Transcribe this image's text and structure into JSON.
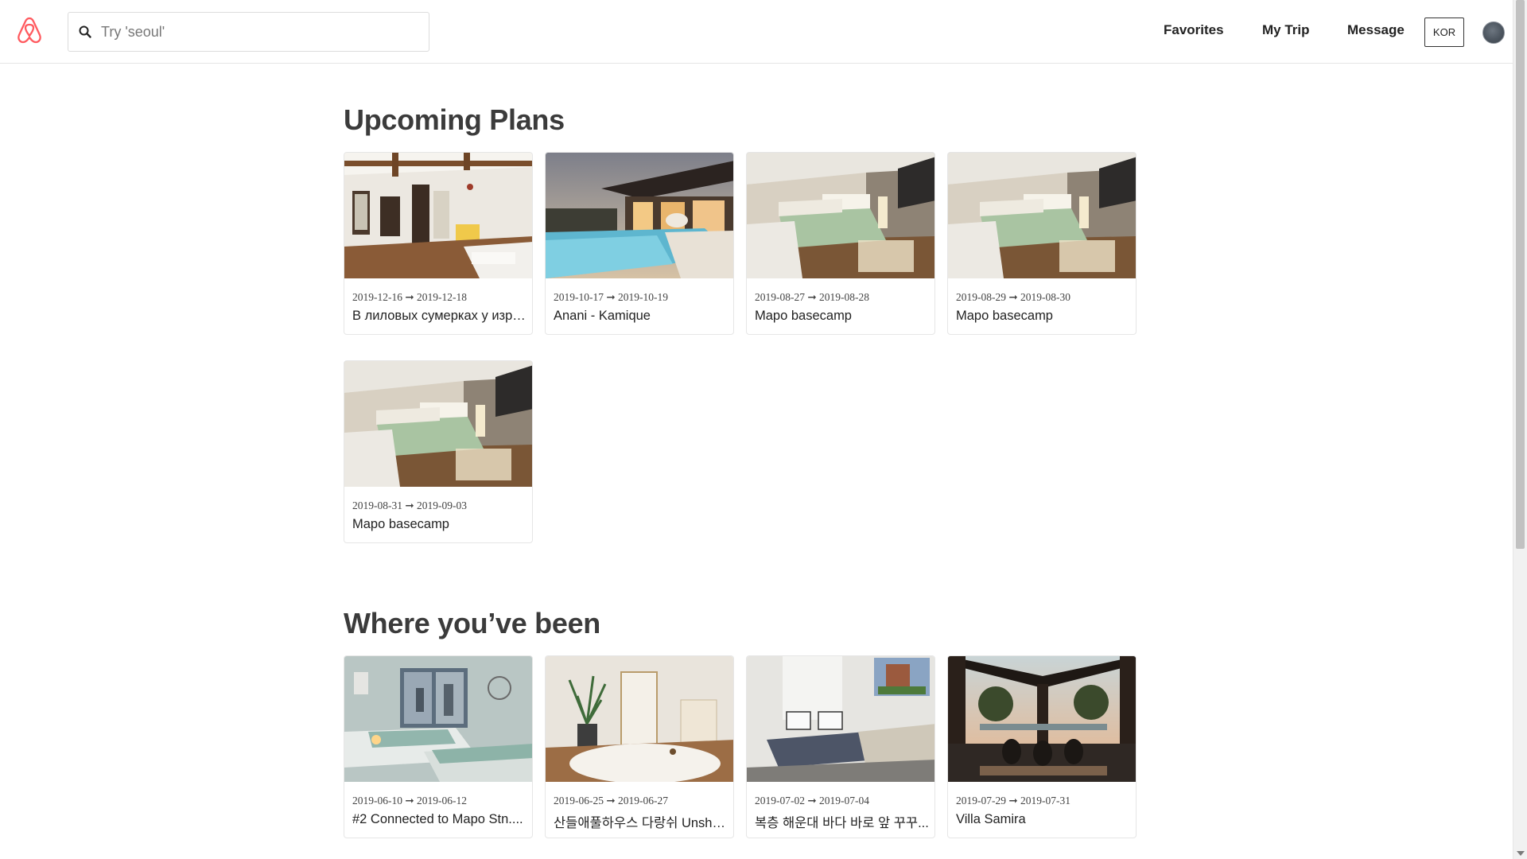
{
  "header": {
    "search_placeholder": "Try 'seoul'",
    "nav": [
      "Favorites",
      "My Trip",
      "Message"
    ],
    "lang": "KOR",
    "brand_color": "#ff5a5f"
  },
  "upcoming": {
    "title": "Upcoming Plans",
    "cards": [
      {
        "dates": "2019-12-16 ➞ 2019-12-18",
        "name": "В лиловых сумерках у изра...",
        "image": "loft-living-room"
      },
      {
        "dates": "2019-10-17 ➞ 2019-10-19",
        "name": "Anani - Kamique",
        "image": "pool-villa-dusk"
      },
      {
        "dates": "2019-08-27 ➞ 2019-08-28",
        "name": "Mapo basecamp",
        "image": "bedroom-green-bed"
      },
      {
        "dates": "2019-08-29 ➞ 2019-08-30",
        "name": "Mapo basecamp",
        "image": "bedroom-green-bed"
      },
      {
        "dates": "2019-08-31 ➞ 2019-09-03",
        "name": "Mapo basecamp",
        "image": "bedroom-green-bed"
      }
    ]
  },
  "been": {
    "title": "Where you’ve been",
    "cards": [
      {
        "dates": "2019-06-10 ➞ 2019-06-12",
        "name": "#2 Connected to Mapo Stn....",
        "image": "twin-bedroom-city-view"
      },
      {
        "dates": "2019-06-25 ➞ 2019-06-27",
        "name": "산들애풀하우스 다랑쉬 Unsha...",
        "image": "white-room-plant"
      },
      {
        "dates": "2019-07-02 ➞ 2019-07-04",
        "name": "복층 해운대 바다 바로 앞 꾸꾸...",
        "image": "studio-sofa-bed"
      },
      {
        "dates": "2019-07-29 ➞ 2019-07-31",
        "name": "Villa Samira",
        "image": "villa-pavilion-sunset"
      }
    ]
  }
}
